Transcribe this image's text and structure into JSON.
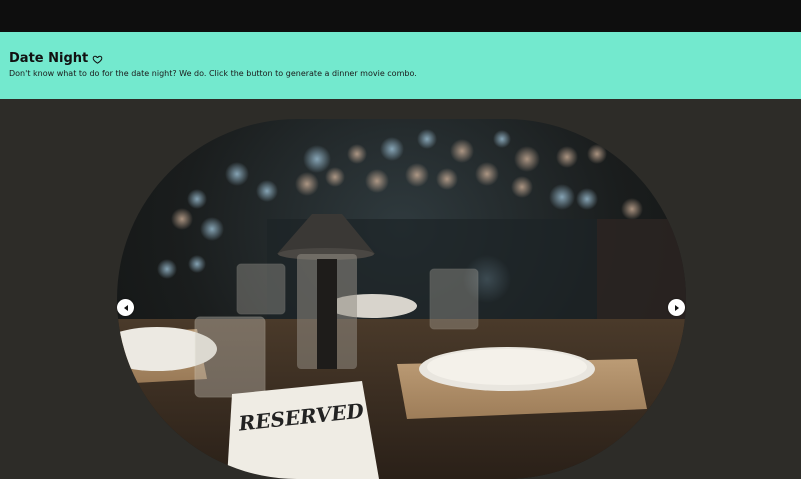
{
  "header": {
    "title": "Date Night",
    "title_icon": "heart-outline-icon",
    "subtitle": "Don't know what to do for the date night? We do. Click the button to generate a dinner movie combo."
  },
  "carousel": {
    "image_sign_text": "RESERVED",
    "prev_icon": "chevron-left-icon",
    "next_icon": "chevron-right-icon"
  },
  "colors": {
    "topbar": "#0e0e0e",
    "hero_bg": "#73e9ce",
    "page_bg": "#2d2c28"
  }
}
